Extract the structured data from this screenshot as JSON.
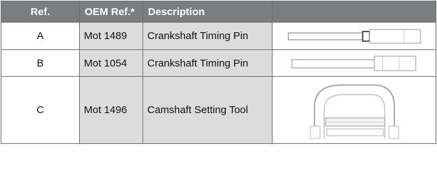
{
  "headers": {
    "ref": "Ref.",
    "oem": "OEM Ref.*",
    "description": "Description",
    "image": ""
  },
  "rows": [
    {
      "ref": "A",
      "oem": "Mot 1489",
      "description": "Crankshaft Timing Pin",
      "image_icon": "crankshaft-timing-pin-icon"
    },
    {
      "ref": "B",
      "oem": "Mot 1054",
      "description": "Crankshaft Timing Pin",
      "image_icon": "crankshaft-timing-pin-icon"
    },
    {
      "ref": "C",
      "oem": "Mot 1496",
      "description": "Camshaft Setting Tool",
      "image_icon": "camshaft-setting-tool-icon"
    }
  ],
  "colors": {
    "header_bg": "#7b7d80",
    "header_text": "#ffffff",
    "shaded_cell": "#dcdcdc",
    "border": "#6e6e6e"
  }
}
